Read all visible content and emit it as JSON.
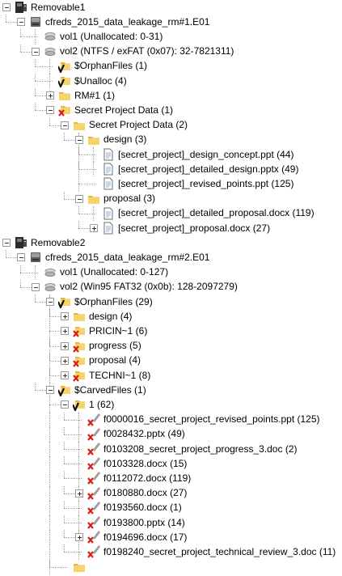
{
  "tree": [
    {
      "label": "Removable1",
      "icon": "removable-drive-icon",
      "depth": 0,
      "expand": "minus",
      "lines": []
    },
    {
      "label": "cfreds_2015_data_leakage_rm#1.E01",
      "icon": "disk-image-icon",
      "depth": 1,
      "expand": "minus",
      "lines": []
    },
    {
      "label": "vol1 (Unallocated: 0-31)",
      "icon": "volume-icon",
      "depth": 2,
      "expand": "none",
      "lines": [
        2
      ]
    },
    {
      "label": "vol2 (NTFS / exFAT (0x07): 32-7821311)",
      "icon": "volume-icon",
      "depth": 2,
      "expand": "minus",
      "lines": []
    },
    {
      "label": "$OrphanFiles (1)",
      "icon": "folder-v-icon",
      "depth": 3,
      "expand": "none",
      "lines": [
        3
      ]
    },
    {
      "label": "$Unalloc (4)",
      "icon": "folder-v-icon",
      "depth": 3,
      "expand": "none",
      "lines": [
        3
      ]
    },
    {
      "label": "RM#1 (1)",
      "icon": "folder-icon",
      "depth": 3,
      "expand": "plus",
      "lines": []
    },
    {
      "label": "Secret Project Data (1)",
      "icon": "folder-x-icon",
      "depth": 3,
      "expand": "minus",
      "lines": []
    },
    {
      "label": "Secret Project Data (2)",
      "icon": "folder-icon",
      "depth": 4,
      "expand": "minus",
      "lines": []
    },
    {
      "label": "design (3)",
      "icon": "folder-icon",
      "depth": 5,
      "expand": "minus",
      "lines": [
        5
      ]
    },
    {
      "label": "[secret_project]_design_concept.ppt (44)",
      "icon": "document-icon",
      "depth": 6,
      "expand": "none",
      "lines": [
        5,
        6
      ]
    },
    {
      "label": "[secret_project]_detailed_design.pptx (49)",
      "icon": "document-icon",
      "depth": 6,
      "expand": "none",
      "lines": [
        5,
        6
      ]
    },
    {
      "label": "[secret_project]_revised_points.ppt (125)",
      "icon": "document-icon",
      "depth": 6,
      "expand": "none",
      "lines": [
        5
      ]
    },
    {
      "label": "proposal (3)",
      "icon": "folder-icon",
      "depth": 5,
      "expand": "minus",
      "lines": []
    },
    {
      "label": "[secret_project]_detailed_proposal.docx (119)",
      "icon": "document-icon",
      "depth": 6,
      "expand": "none",
      "lines": [
        6
      ]
    },
    {
      "label": "[secret_project]_proposal.docx (27)",
      "icon": "document-icon",
      "depth": 6,
      "expand": "plus",
      "lines": []
    },
    {
      "label": "Removable2",
      "icon": "removable-drive-icon",
      "depth": 0,
      "expand": "minus",
      "lines": []
    },
    {
      "label": "cfreds_2015_data_leakage_rm#2.E01",
      "icon": "disk-image-icon",
      "depth": 1,
      "expand": "minus",
      "lines": []
    },
    {
      "label": "vol1 (Unallocated: 0-127)",
      "icon": "volume-icon",
      "depth": 2,
      "expand": "none",
      "lines": [
        2
      ]
    },
    {
      "label": "vol2 (Win95 FAT32 (0x0b): 128-2097279)",
      "icon": "volume-icon",
      "depth": 2,
      "expand": "minus",
      "lines": []
    },
    {
      "label": "$OrphanFiles (29)",
      "icon": "folder-v-icon",
      "depth": 3,
      "expand": "minus",
      "lines": [
        3
      ]
    },
    {
      "label": "design (4)",
      "icon": "folder-icon",
      "depth": 4,
      "expand": "plus",
      "lines": [
        3
      ]
    },
    {
      "label": "PRICIN~1 (6)",
      "icon": "folder-x-icon",
      "depth": 4,
      "expand": "plus",
      "lines": [
        3
      ]
    },
    {
      "label": "progress (5)",
      "icon": "folder-x-icon",
      "depth": 4,
      "expand": "plus",
      "lines": [
        3
      ]
    },
    {
      "label": "proposal (4)",
      "icon": "folder-x-icon",
      "depth": 4,
      "expand": "plus",
      "lines": [
        3
      ]
    },
    {
      "label": "TECHNI~1 (8)",
      "icon": "folder-x-icon",
      "depth": 4,
      "expand": "plus",
      "lines": [
        3
      ]
    },
    {
      "label": "$CarvedFiles (1)",
      "icon": "folder-v-icon",
      "depth": 3,
      "expand": "minus",
      "lines": [
        3
      ]
    },
    {
      "label": "1 (62)",
      "icon": "folder-v-icon",
      "depth": 4,
      "expand": "minus",
      "lines": [
        3
      ]
    },
    {
      "label": "f0000016_secret_project_revised_points.ppt (125)",
      "icon": "deleted-file-icon",
      "depth": 5,
      "expand": "none",
      "lines": [
        3,
        5
      ]
    },
    {
      "label": "f0028432.pptx (49)",
      "icon": "deleted-file-icon",
      "depth": 5,
      "expand": "none",
      "lines": [
        3,
        5
      ]
    },
    {
      "label": "f0103208_secret_project_progress_3.doc (2)",
      "icon": "deleted-file-icon",
      "depth": 5,
      "expand": "none",
      "lines": [
        3,
        5
      ]
    },
    {
      "label": "f0103328.docx (15)",
      "icon": "deleted-file-icon",
      "depth": 5,
      "expand": "none",
      "lines": [
        3,
        5
      ]
    },
    {
      "label": "f0112072.docx (119)",
      "icon": "deleted-file-icon",
      "depth": 5,
      "expand": "none",
      "lines": [
        3,
        5
      ]
    },
    {
      "label": "f0180880.docx (27)",
      "icon": "deleted-file-icon",
      "depth": 5,
      "expand": "plus",
      "lines": [
        3,
        5
      ]
    },
    {
      "label": "f0193560.docx (1)",
      "icon": "deleted-file-icon",
      "depth": 5,
      "expand": "none",
      "lines": [
        3,
        5
      ]
    },
    {
      "label": "f0193800.pptx (14)",
      "icon": "deleted-file-icon",
      "depth": 5,
      "expand": "none",
      "lines": [
        3,
        5
      ]
    },
    {
      "label": "f0194696.docx (17)",
      "icon": "deleted-file-icon",
      "depth": 5,
      "expand": "plus",
      "lines": [
        3,
        5
      ]
    },
    {
      "label": "f0198240_secret_project_technical_review_3.doc (11)",
      "icon": "deleted-file-icon",
      "depth": 5,
      "expand": "none",
      "lines": [
        3,
        5
      ]
    },
    {
      "label": "",
      "icon": "folder-icon",
      "depth": 4,
      "expand": "none",
      "lines": [
        3
      ]
    }
  ],
  "colors": {
    "tree_line": "#a0a0a0",
    "folder": "#f0c24a",
    "deleted_mark": "#d81b1b",
    "verified_mark": "#111111"
  }
}
